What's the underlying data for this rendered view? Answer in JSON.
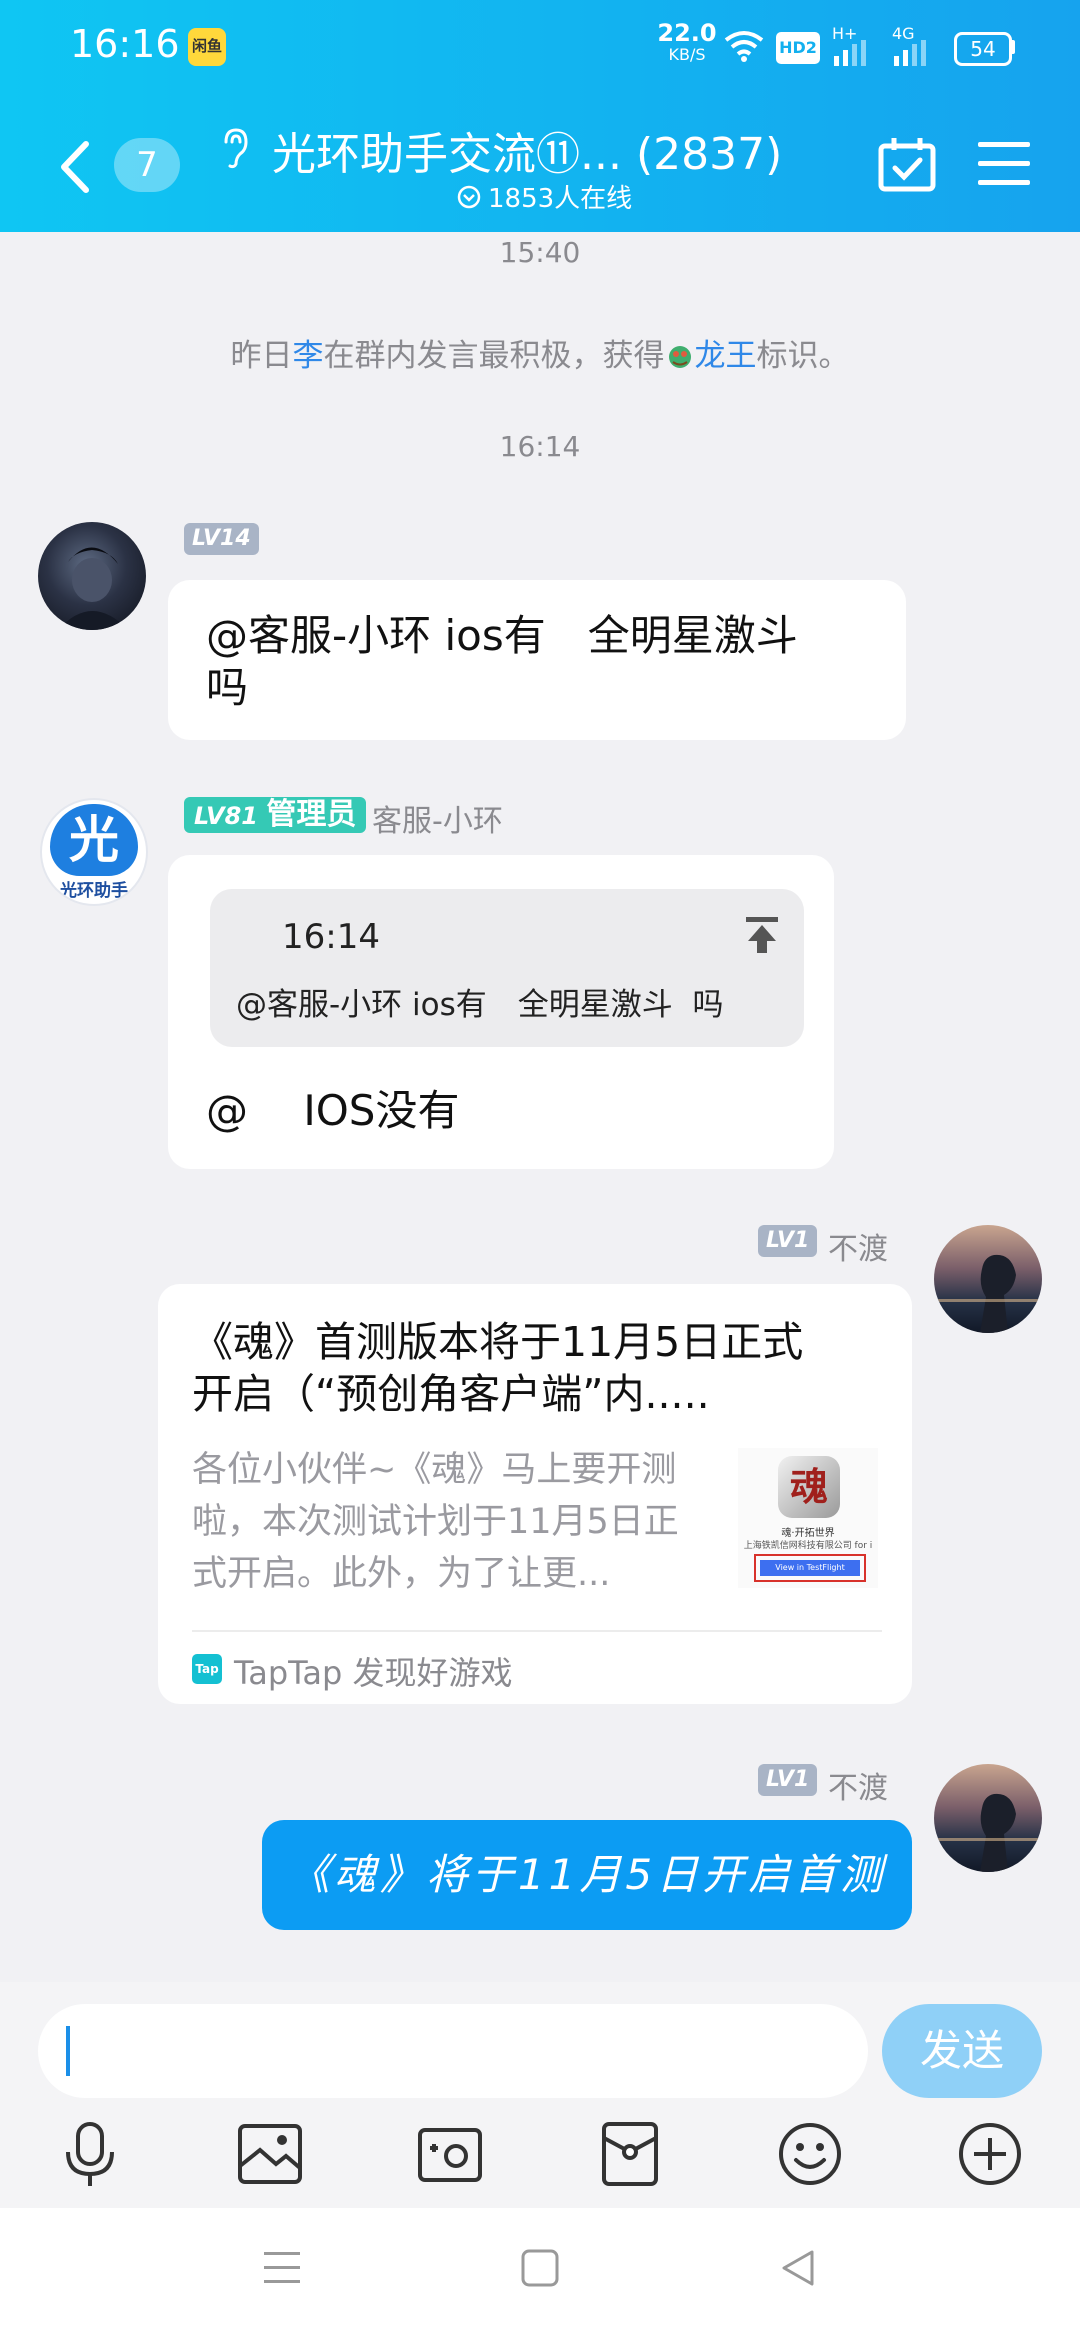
{
  "status_bar": {
    "time": "16:16",
    "app_badge": "闲鱼",
    "net_speed_value": "22.0",
    "net_speed_unit": "KB/S",
    "hd": "HD2",
    "signal1": "H+",
    "signal2": "4G",
    "battery": "54"
  },
  "header": {
    "unread_count": "7",
    "title": "光环助手交流⑪... (2837)",
    "online": "1853人在线"
  },
  "chat": {
    "time1": "15:40",
    "system_notice": {
      "prefix": "昨日",
      "user": "李",
      "middle": "在群内发言最积极，获得",
      "title": "龙王",
      "suffix": "标识。"
    },
    "time2": "16:14",
    "msg1": {
      "level": "LV14",
      "text_line1": "@客服-小环 ios有　全明星激斗",
      "text_line2": "吗"
    },
    "msg2": {
      "level": "LV81",
      "role": "管理员",
      "name": "客服-小环",
      "quote_time": "16:14",
      "quote_text": "@客服-小环 ios有　全明星激斗  吗",
      "text": "@　 IOS没有",
      "avatar_glyph": "光",
      "avatar_caption": "光环助手"
    },
    "msg3": {
      "level": "LV1",
      "name": "不渡",
      "card_title_line1": "《魂》首测版本将于11月5日正式",
      "card_title_line2": "开启（“预创角客户端”内.....",
      "card_desc_line1": "各位小伙伴~《魂》马上要开测",
      "card_desc_line2": "啦，本次测试计划于11月5日正",
      "card_desc_line3": "式开启。此外，为了让更...",
      "thumb_title": "魂",
      "thumb_line1": "魂·开拓世界",
      "thumb_line2": "上海铁凯信网科技有限公司 for i",
      "thumb_button": "View in TestFlight",
      "source_logo": "Tap",
      "source": "TapTap 发现好游戏"
    },
    "msg4": {
      "level": "LV1",
      "name": "不渡",
      "text": "《魂》将于11月5日开启首测"
    }
  },
  "composer": {
    "send_label": "发送",
    "input_value": ""
  },
  "colors": {
    "header_start": "#0fc6f3",
    "header_end": "#16a3ee",
    "link_blue": "#2f88e8",
    "sent_bubble": "#0c9cf3",
    "send_button": "#8fd0f7",
    "admin_badge": "#35c9b5"
  }
}
